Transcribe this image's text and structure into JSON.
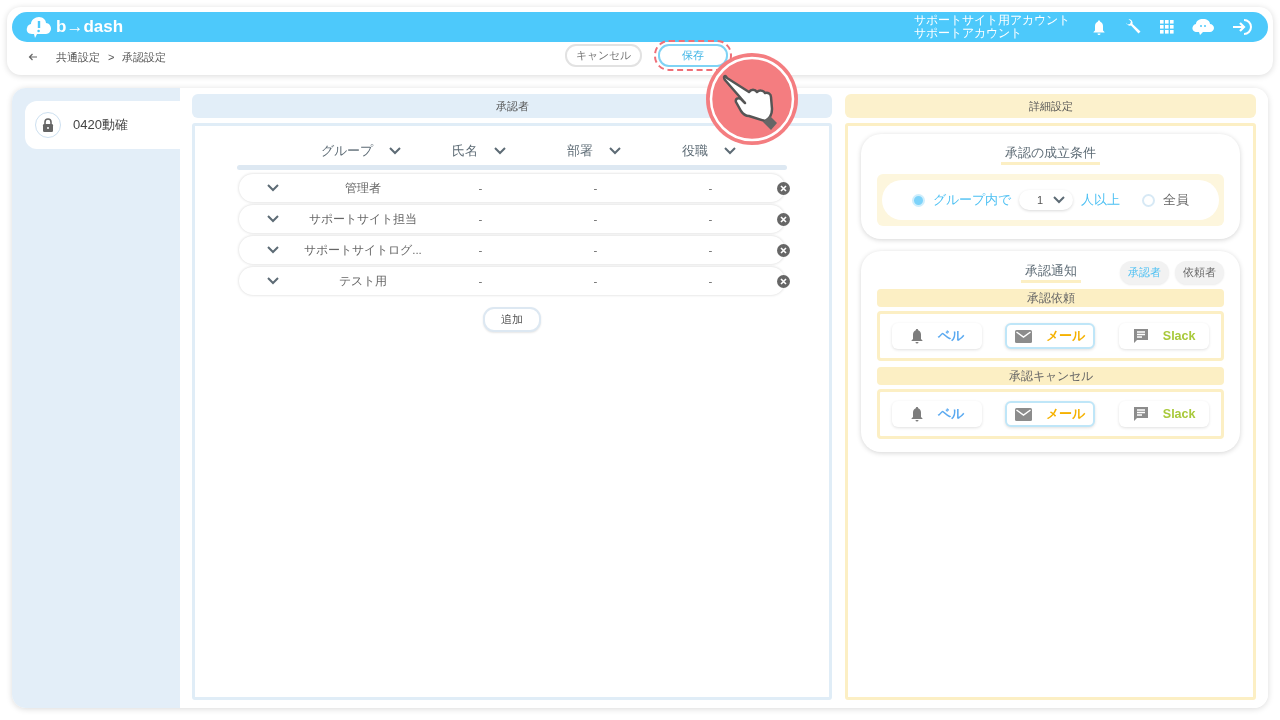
{
  "top_bar": {
    "logo": "b→dash",
    "account_lines": [
      "サポートサイト用アカウント",
      "サポートアカウント"
    ]
  },
  "breadcrumb": {
    "items": [
      "共通設定",
      "承認設定"
    ],
    "separator": ">"
  },
  "actions": {
    "cancel": "キャンセル",
    "save": "保存"
  },
  "sidebar": {
    "items": [
      {
        "label": "0420動確",
        "selected": true
      }
    ]
  },
  "approvers": {
    "title": "承認者",
    "columns": [
      "グループ",
      "氏名",
      "部署",
      "役職"
    ],
    "rows": [
      {
        "group": "管理者",
        "name": "-",
        "department": "-",
        "role": "-"
      },
      {
        "group": "サポートサイト担当",
        "name": "-",
        "department": "-",
        "role": "-"
      },
      {
        "group": "サポートサイトログ...",
        "name": "-",
        "department": "-",
        "role": "-"
      },
      {
        "group": "テスト用",
        "name": "-",
        "department": "-",
        "role": "-"
      }
    ],
    "add_button": "追加"
  },
  "details": {
    "title": "詳細設定",
    "condition": {
      "title": "承認の成立条件",
      "options": [
        {
          "kind": "count",
          "label": "グループ内で",
          "value": "1",
          "suffix": "人以上",
          "selected": true
        },
        {
          "kind": "plain",
          "label": "全員",
          "selected": false
        }
      ]
    },
    "notification": {
      "title": "承認通知",
      "tabs": [
        {
          "label": "承認者",
          "selected": true
        },
        {
          "label": "依頼者",
          "selected": false
        }
      ],
      "sections": [
        {
          "title": "承認依頼",
          "channels": [
            {
              "kind": "bell",
              "label": "ベル",
              "selected": false
            },
            {
              "kind": "mail",
              "label": "メール",
              "selected": true
            },
            {
              "kind": "slack",
              "label": "Slack",
              "selected": false
            }
          ]
        },
        {
          "title": "承認キャンセル",
          "channels": [
            {
              "kind": "bell",
              "label": "ベル",
              "selected": false
            },
            {
              "kind": "mail",
              "label": "メール",
              "selected": true
            },
            {
              "kind": "slack",
              "label": "Slack",
              "selected": false
            }
          ]
        }
      ]
    }
  }
}
